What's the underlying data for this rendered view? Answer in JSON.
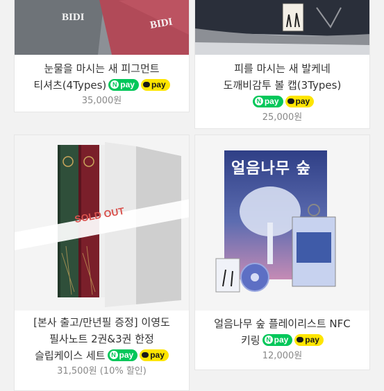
{
  "products": [
    {
      "title_line1": "눈물을 마시는 새 피그먼트",
      "title_line2": "티셔츠(4Types)",
      "price": "35,000원",
      "image_text": "BIDI",
      "npay": "pay",
      "kpay": "pay"
    },
    {
      "title_line1": "피를 마시는 새 발케네",
      "title_line2": "도깨비감투 볼 캡(3Types)",
      "price": "25,000원",
      "image_text": "",
      "npay": "pay",
      "kpay": "pay"
    },
    {
      "title_line1": "[본사 출고/만년필 증정] 이영도",
      "title_line2": "필사노트 2권&3권 한정",
      "title_line3": "슬립케이스 세트",
      "price": "31,500원 (10% 할인)",
      "sold_out": "SOLD OUT",
      "npay": "pay",
      "kpay": "pay"
    },
    {
      "title_line1": "얼음나무 숲 플레이리스트 NFC",
      "title_line2": "키링",
      "price": "12,000원",
      "book_title": "얼음나무 숲",
      "npay": "pay",
      "kpay": "pay"
    }
  ],
  "colors": {
    "npay": "#03c75a",
    "kpay": "#fee500",
    "sold_out": "#d9534f"
  }
}
